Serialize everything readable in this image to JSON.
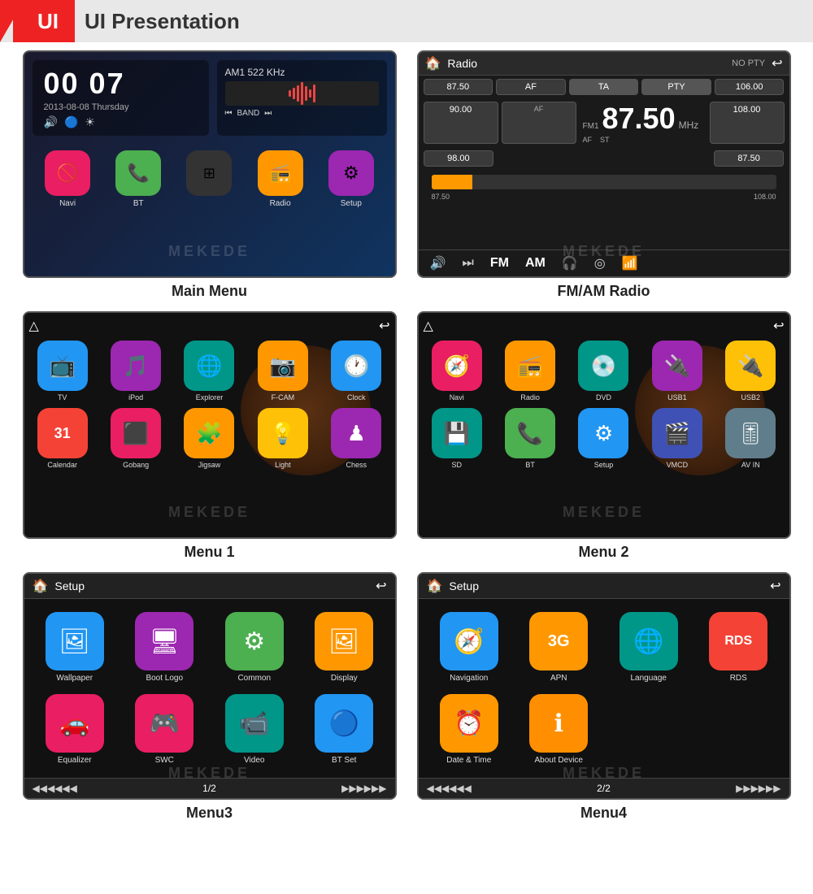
{
  "header": {
    "red_label": "UI",
    "main_title": "UI Presentation"
  },
  "screens": {
    "main_menu": {
      "time": "00 07",
      "date": "2013-08-08 Thursday",
      "radio_freq": "AM1 522 KHz",
      "band": "BAND",
      "icons": [
        {
          "label": "Navi",
          "emoji": "🚫",
          "color": "icon-pink"
        },
        {
          "label": "BT",
          "emoji": "📞",
          "color": "icon-green"
        },
        {
          "label": "",
          "emoji": "⊞",
          "color": "icon-dark"
        },
        {
          "label": "Radio",
          "emoji": "📻",
          "color": "icon-orange"
        },
        {
          "label": "Setup",
          "emoji": "⚙",
          "color": "icon-purple"
        }
      ],
      "caption": "Main Menu"
    },
    "radio": {
      "title": "Radio",
      "no_pty": "NO PTY",
      "freq_main": "87.50",
      "freq_label": "FM1",
      "freq_mhz": "MHz",
      "af_label": "AF",
      "st_label": "ST",
      "slider_start": "87.50",
      "slider_end": "108.00",
      "presets": [
        "87.50",
        "AF",
        "TA",
        "PTY",
        "106.00",
        "90.00",
        "",
        "",
        "",
        "108.00",
        "98.00",
        "",
        "",
        "",
        "87.50"
      ],
      "bottom_btns": [
        "🔊",
        "⏭",
        "FM",
        "AM",
        "🎧",
        "◎",
        "📶"
      ],
      "caption": "FM/AM Radio"
    },
    "menu1": {
      "apps": [
        {
          "label": "TV",
          "emoji": "📺",
          "color": "icon-blue"
        },
        {
          "label": "iPod",
          "emoji": "🎵",
          "color": "icon-purple"
        },
        {
          "label": "Explorer",
          "emoji": "🌐",
          "color": "icon-teal"
        },
        {
          "label": "F-CAM",
          "emoji": "📷",
          "color": "icon-orange"
        },
        {
          "label": "Clock",
          "emoji": "🕐",
          "color": "icon-blue"
        },
        {
          "label": "Calendar",
          "emoji": "31",
          "color": "icon-red"
        },
        {
          "label": "Gobang",
          "emoji": "⬛",
          "color": "icon-pink"
        },
        {
          "label": "Jigsaw",
          "emoji": "🧩",
          "color": "icon-orange"
        },
        {
          "label": "Light",
          "emoji": "💡",
          "color": "icon-yellow"
        },
        {
          "label": "Chess",
          "emoji": "♟",
          "color": "icon-purple"
        }
      ],
      "caption": "Menu 1"
    },
    "menu2": {
      "apps": [
        {
          "label": "Navi",
          "emoji": "🧭",
          "color": "icon-pink"
        },
        {
          "label": "Radio",
          "emoji": "📻",
          "color": "icon-orange"
        },
        {
          "label": "DVD",
          "emoji": "💿",
          "color": "icon-teal"
        },
        {
          "label": "USB1",
          "emoji": "🔌",
          "color": "icon-purple"
        },
        {
          "label": "USB2",
          "emoji": "🔌",
          "color": "icon-yellow"
        },
        {
          "label": "SD",
          "emoji": "💾",
          "color": "icon-teal"
        },
        {
          "label": "BT",
          "emoji": "📞",
          "color": "icon-green"
        },
        {
          "label": "Setup",
          "emoji": "⚙",
          "color": "icon-blue"
        },
        {
          "label": "VMCD",
          "emoji": "🎬",
          "color": "icon-blue"
        },
        {
          "label": "AV IN",
          "emoji": "🎚",
          "color": "icon-grey"
        }
      ],
      "caption": "Menu 2"
    },
    "menu3": {
      "title": "Setup",
      "apps": [
        {
          "label": "Wallpaper",
          "emoji": "🖼",
          "color": "icon-blue"
        },
        {
          "label": "Boot Logo",
          "emoji": "🖥",
          "color": "icon-purple"
        },
        {
          "label": "Common",
          "emoji": "⚙",
          "color": "icon-green"
        },
        {
          "label": "Display",
          "emoji": "🖼",
          "color": "icon-orange"
        },
        {
          "label": "Equalizer",
          "emoji": "🚗",
          "color": "icon-pink"
        },
        {
          "label": "SWC",
          "emoji": "🎮",
          "color": "icon-pink"
        },
        {
          "label": "Video",
          "emoji": "📹",
          "color": "icon-teal"
        },
        {
          "label": "BT Set",
          "emoji": "🔵",
          "color": "icon-blue"
        }
      ],
      "page": "1/2",
      "caption": "Menu3"
    },
    "menu4": {
      "title": "Setup",
      "apps": [
        {
          "label": "Navigation",
          "emoji": "🧭",
          "color": "icon-blue"
        },
        {
          "label": "APN",
          "emoji": "3G",
          "color": "icon-orange"
        },
        {
          "label": "Language",
          "emoji": "🌐",
          "color": "icon-teal"
        },
        {
          "label": "RDS",
          "emoji": "RDS",
          "color": "icon-red"
        },
        {
          "label": "Date & Time",
          "emoji": "⏰",
          "color": "icon-orange"
        },
        {
          "label": "About Device",
          "emoji": "ℹ",
          "color": "icon-orange"
        }
      ],
      "page": "2/2",
      "caption": "Menu4"
    }
  }
}
